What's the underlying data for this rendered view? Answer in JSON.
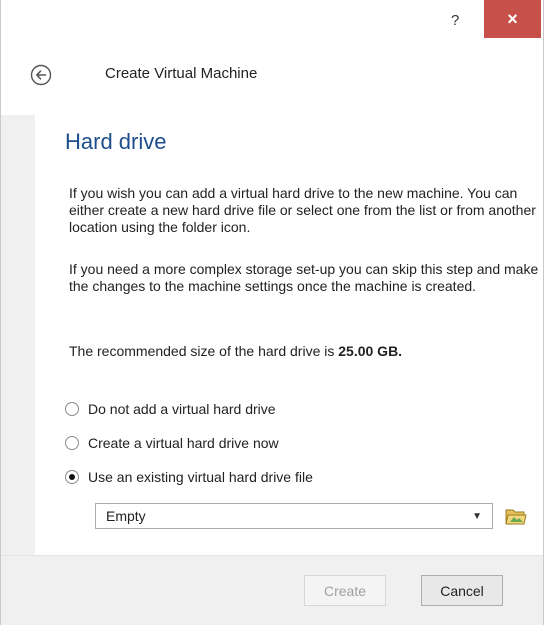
{
  "window": {
    "help_label": "?",
    "close_label": "×"
  },
  "header": {
    "title": "Create Virtual Machine",
    "back_icon": "arrow-left-circle-icon"
  },
  "page": {
    "title": "Hard drive",
    "paragraph1": "If you wish you can add a virtual hard drive to the new machine. You can either create a new hard drive file or select one from the list or from another location using the folder icon.",
    "paragraph2": "If you need a more complex storage set-up you can skip this step and make the changes to the machine settings once the machine is created.",
    "recommended_prefix": "The recommended size of the hard drive is ",
    "recommended_size": "25.00 GB."
  },
  "options": [
    {
      "label": "Do not add a virtual hard drive",
      "checked": false
    },
    {
      "label": "Create a virtual hard drive now",
      "checked": false
    },
    {
      "label": "Use an existing virtual hard drive file",
      "checked": true
    }
  ],
  "file_select": {
    "value": "Empty",
    "folder_icon": "folder-open-icon"
  },
  "buttons": {
    "create": "Create",
    "cancel": "Cancel"
  },
  "colors": {
    "title_blue": "#1f4e8c",
    "close_red": "#c7504a",
    "folder_green": "#6aa84f"
  }
}
